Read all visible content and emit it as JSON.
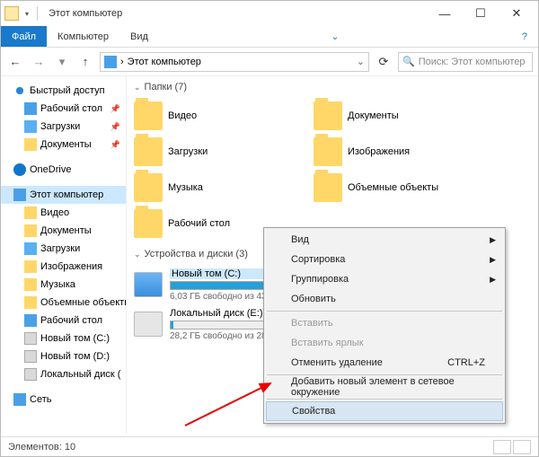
{
  "title": "Этот компьютер",
  "ribbon": {
    "file": "Файл",
    "computer": "Компьютер",
    "view": "Вид",
    "help": "?"
  },
  "address": {
    "path": "Этот компьютер",
    "search_placeholder": "Поиск: Этот компьютер"
  },
  "nav": {
    "quick": "Быстрый доступ",
    "desktop": "Рабочий стол",
    "downloads": "Загрузки",
    "documents": "Документы",
    "onedrive": "OneDrive",
    "thispc": "Этот компьютер",
    "videos": "Видео",
    "documents2": "Документы",
    "downloads2": "Загрузки",
    "images": "Изображения",
    "music": "Музыка",
    "objects3d": "Объемные объекть",
    "desktop2": "Рабочий стол",
    "drive_c": "Новый том (C:)",
    "drive_d": "Новый том (D:)",
    "drive_e": "Локальный диск (",
    "network": "Сеть"
  },
  "sections": {
    "folders": "Папки (7)",
    "drives": "Устройства и диски (3)"
  },
  "folders": {
    "videos": "Видео",
    "documents": "Документы",
    "downloads": "Загрузки",
    "images": "Изображения",
    "music": "Музыка",
    "objects3d": "Объемные объекты",
    "desktop": "Рабочий стол"
  },
  "drives": {
    "c_name": "Новый том (C:)",
    "c_sub": "6,03 ГБ свободно из 43",
    "e_name": "Локальный диск (E:)",
    "e_sub": "28,2 ГБ свободно из 28"
  },
  "ctx": {
    "view": "Вид",
    "sort": "Сортировка",
    "group": "Группировка",
    "refresh": "Обновить",
    "paste": "Вставить",
    "paste_shortcut": "Вставить ярлык",
    "undo": "Отменить удаление",
    "undo_key": "CTRL+Z",
    "addnet": "Добавить новый элемент в сетевое окружение",
    "properties": "Свойства"
  },
  "status": {
    "elements": "Элементов: 10"
  }
}
